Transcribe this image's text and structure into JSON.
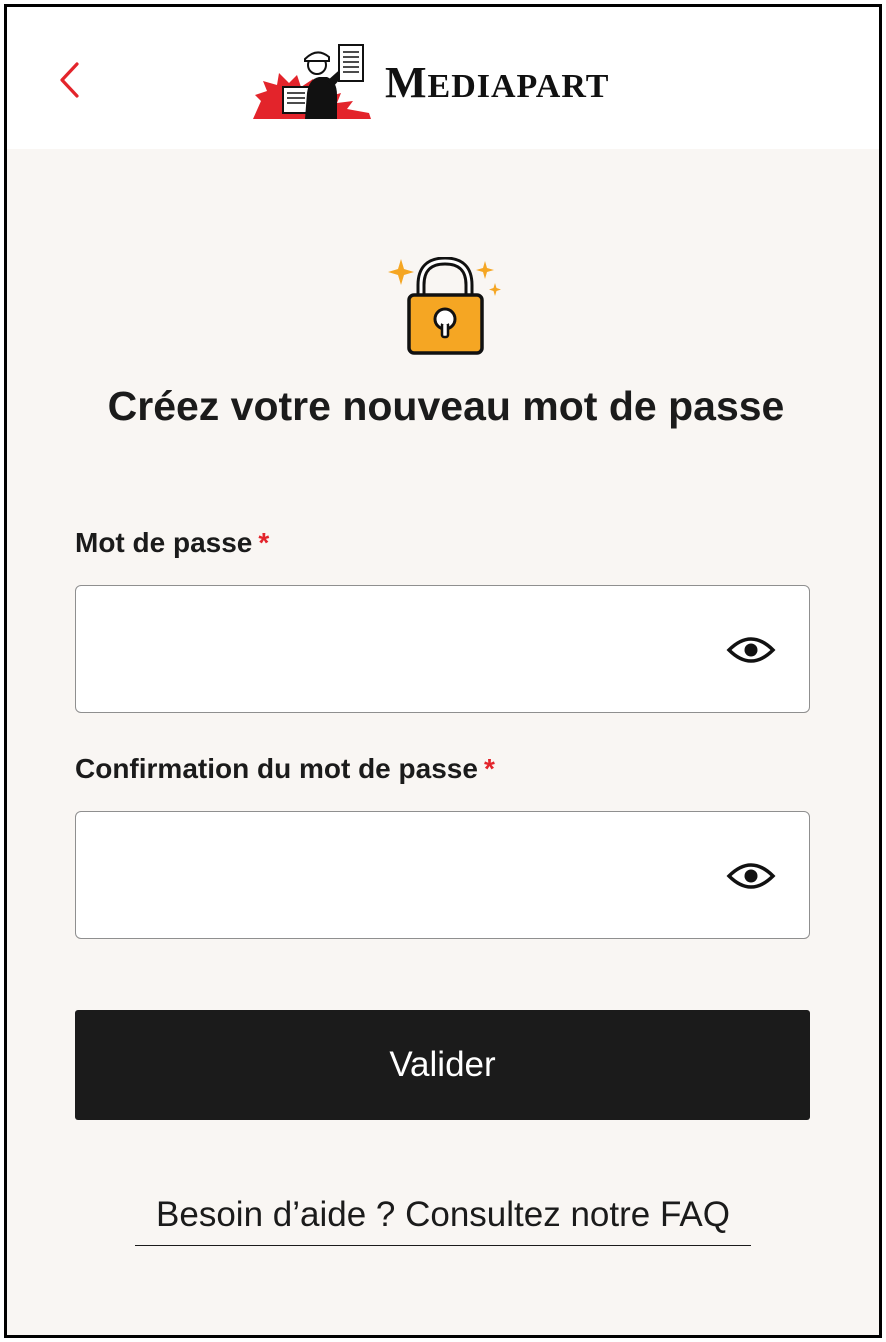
{
  "header": {
    "back_icon": "chevron-left-icon",
    "logo_text_initial": "M",
    "logo_text_rest": "EDIAPART",
    "accent_color": "#e3242b"
  },
  "hero": {
    "icon": "padlock-sparkle-icon",
    "lock_color": "#f5a623",
    "title": "Créez votre nouveau mot de passe"
  },
  "form": {
    "password": {
      "label": "Mot de passe",
      "required_mark": "*",
      "value": "",
      "toggle_icon": "eye-icon"
    },
    "confirm_password": {
      "label": "Confirmation du mot de passe",
      "required_mark": "*",
      "value": "",
      "toggle_icon": "eye-icon"
    },
    "submit_label": "Valider"
  },
  "footer": {
    "help_link": "Besoin d’aide ? Consultez notre FAQ"
  }
}
